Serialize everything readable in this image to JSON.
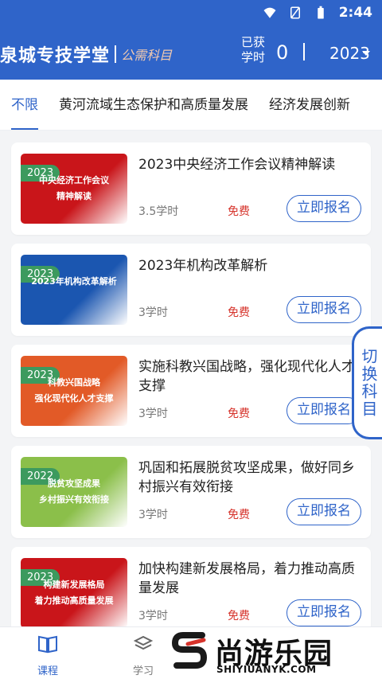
{
  "status": {
    "time": "2:44",
    "icons": [
      "wifi-icon",
      "sim-icon",
      "battery-icon"
    ]
  },
  "header": {
    "brand_name": "泉城专技学堂",
    "brand_sub": "公需科目",
    "hours_label": "已获\n学时",
    "hours_value": "0",
    "year": "2023"
  },
  "tabs": [
    {
      "label": "不限",
      "active": true
    },
    {
      "label": "黄河流域生态保护和高质量发展",
      "active": false
    },
    {
      "label": "经济发展创新",
      "active": false
    }
  ],
  "courses": [
    {
      "badge": "2023",
      "thumb_text": "中央经济工作会议\n精神解读",
      "title": "2023中央经济工作会议精神解读",
      "hours": "3.5学时",
      "price": "免费",
      "action": "立即报名",
      "thumb_color": "#c9151a"
    },
    {
      "badge": "2023",
      "thumb_text": "2023年机构改革解析",
      "title": "2023年机构改革解析",
      "hours": "3学时",
      "price": "免费",
      "action": "立即报名",
      "thumb_color": "#1b56b0"
    },
    {
      "badge": "2023",
      "thumb_text": "科教兴国战略\n强化现代化人才支撑",
      "title": "实施科教兴国战略，强化现代化人才支撑",
      "hours": "3学时",
      "price": "免费",
      "action": "立即报名",
      "thumb_color": "#e25a27"
    },
    {
      "badge": "2022",
      "thumb_text": "脱贫攻坚成果\n乡村振兴有效衔接",
      "title": "巩固和拓展脱贫攻坚成果，做好同乡村振兴有效衔接",
      "hours": "3学时",
      "price": "免费",
      "action": "立即报名",
      "thumb_color": "#8bbf4a"
    },
    {
      "badge": "2023",
      "thumb_text": "构建新发展格局\n着力推动高质量发展",
      "title": "加快构建新发展格局，着力推动高质量发展",
      "hours": "3学时",
      "price": "免费",
      "action": "立即报名",
      "thumb_color": "#c9151a"
    }
  ],
  "switch_label": "切换科目",
  "bottom_nav": [
    {
      "label": "课程",
      "icon": "book-icon",
      "active": true
    },
    {
      "label": "学习",
      "icon": "stack-icon",
      "active": false
    }
  ],
  "watermark": {
    "big": "尚游乐园",
    "small": "SHIYIUANYK.COM"
  }
}
